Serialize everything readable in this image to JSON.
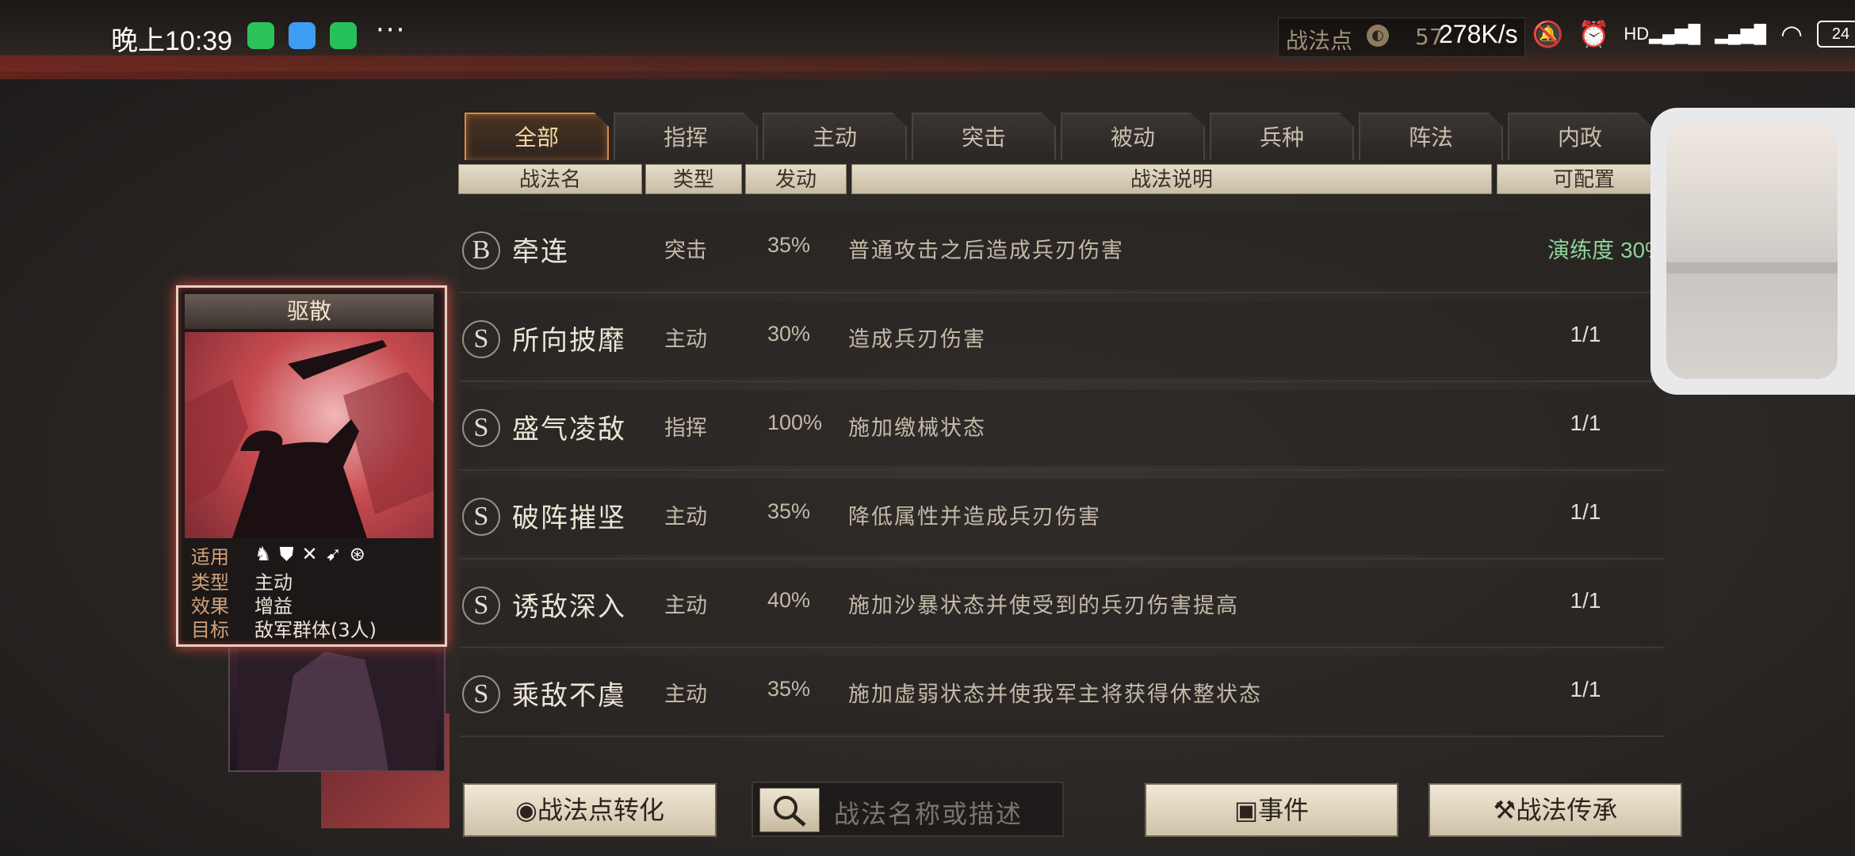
{
  "status_bar": {
    "time": "晚上10:39",
    "more": "···",
    "net_speed": "278K/s",
    "battery": "24",
    "signal_hd": "HD"
  },
  "resource": {
    "label": "战法点",
    "value": "57"
  },
  "tabs": [
    {
      "label": "全部",
      "active": true
    },
    {
      "label": "指挥",
      "active": false
    },
    {
      "label": "主动",
      "active": false
    },
    {
      "label": "突击",
      "active": false
    },
    {
      "label": "被动",
      "active": false
    },
    {
      "label": "兵种",
      "active": false
    },
    {
      "label": "阵法",
      "active": false
    },
    {
      "label": "内政",
      "active": false
    }
  ],
  "columns": {
    "name": "战法名",
    "type": "类型",
    "rate": "发动",
    "desc": "战法说明",
    "config": "可配置"
  },
  "rows": [
    {
      "grade": "B",
      "name": "牵连",
      "type": "突击",
      "rate": "35%",
      "desc": "普通攻击之后造成兵刃伤害",
      "config": "演练度 30%",
      "config_green": true
    },
    {
      "grade": "S",
      "name": "所向披靡",
      "type": "主动",
      "rate": "30%",
      "desc": "造成兵刃伤害",
      "config": "1/1"
    },
    {
      "grade": "S",
      "name": "盛气凌敌",
      "type": "指挥",
      "rate": "100%",
      "desc": "施加缴械状态",
      "config": "1/1"
    },
    {
      "grade": "S",
      "name": "破阵摧坚",
      "type": "主动",
      "rate": "35%",
      "desc": "降低属性并造成兵刃伤害",
      "config": "1/1"
    },
    {
      "grade": "S",
      "name": "诱敌深入",
      "type": "主动",
      "rate": "40%",
      "desc": "施加沙暴状态并使受到的兵刃伤害提高",
      "config": "1/1"
    },
    {
      "grade": "S",
      "name": "乘敌不虞",
      "type": "主动",
      "rate": "35%",
      "desc": "施加虚弱状态并使我军主将获得休整状态",
      "config": "1/1"
    }
  ],
  "card": {
    "title": "驱散",
    "labels": {
      "apply": "适用",
      "type": "类型",
      "effect": "效果",
      "target": "目标"
    },
    "type": "主动",
    "effect": "增益",
    "target": "敌军群体(3人)"
  },
  "bottom": {
    "convert": "战法点转化",
    "search_placeholder": "战法名称或描述",
    "events": "事件",
    "inherit": "战法传承"
  },
  "colors": {
    "accent": "#d98b3a",
    "green": "#8fd29a",
    "card_glow": "#d94b3c"
  }
}
